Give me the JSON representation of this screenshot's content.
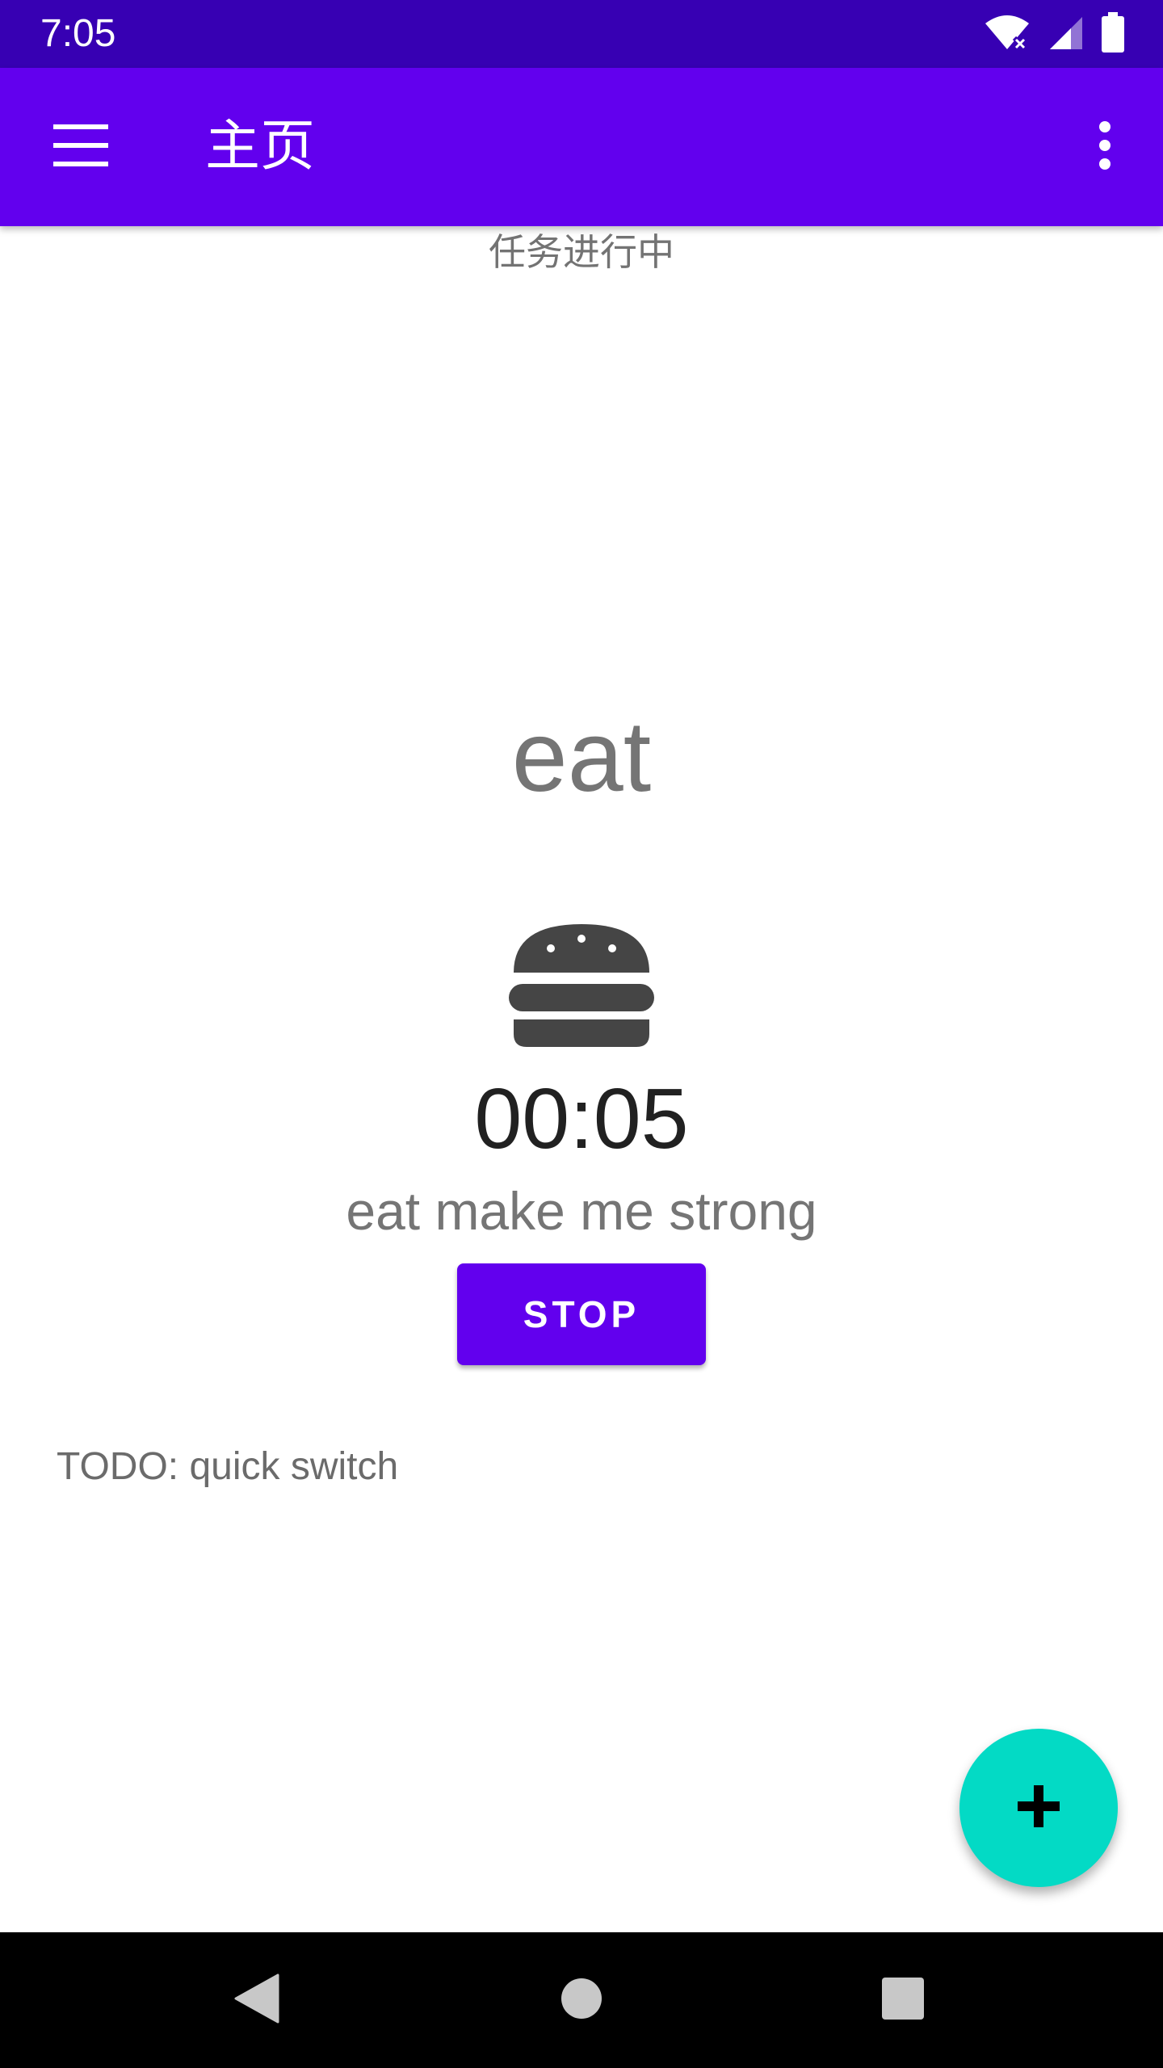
{
  "status_bar": {
    "time": "7:05",
    "icons": [
      "wifi-icon",
      "signal-icon",
      "battery-icon"
    ]
  },
  "app_bar": {
    "title": "主页",
    "menu_icon": "menu-icon",
    "overflow_icon": "more-vert-icon"
  },
  "task": {
    "status": "任务进行中",
    "name": "eat",
    "icon": "burger-icon",
    "timer": "00:05",
    "motto": "eat make me strong",
    "stop_label": "STOP"
  },
  "todo_text": "TODO: quick switch",
  "fab": {
    "icon": "add-icon"
  },
  "nav_bar": {
    "icons": [
      "back-icon",
      "home-icon",
      "recents-icon"
    ]
  },
  "colors": {
    "status_bar": "#3700b3",
    "primary": "#6200ee",
    "fab": "#03dac5",
    "nav_bar": "#000000"
  }
}
